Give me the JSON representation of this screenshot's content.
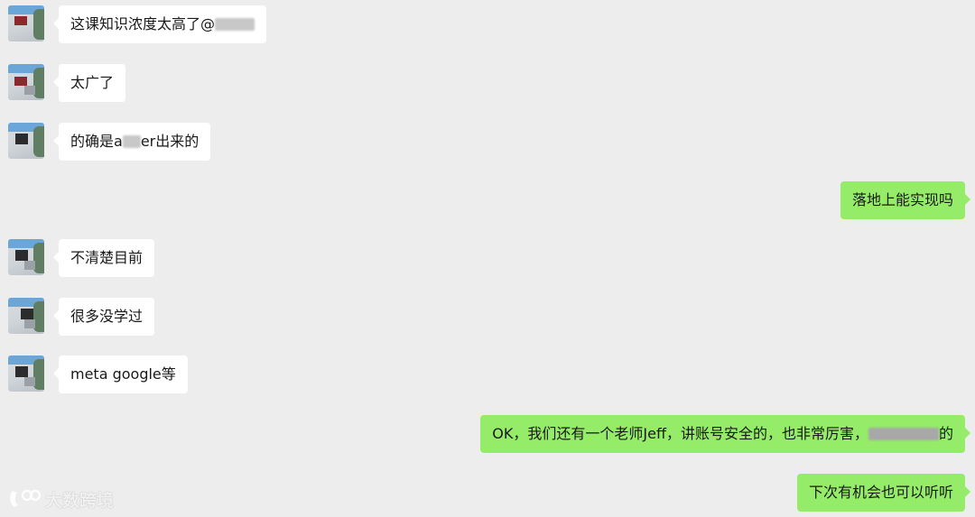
{
  "messages": [
    {
      "side": "left",
      "parts": [
        "这课知识浓度太高了@",
        "█████"
      ]
    },
    {
      "side": "left",
      "parts": [
        "太广了"
      ]
    },
    {
      "side": "left",
      "parts": [
        "的确是a",
        "██",
        "er出来的"
      ]
    },
    {
      "side": "right",
      "parts": [
        "落地上能实现吗"
      ]
    },
    {
      "side": "left",
      "parts": [
        "不清楚目前"
      ]
    },
    {
      "side": "left",
      "parts": [
        "很多没学过"
      ]
    },
    {
      "side": "left",
      "parts": [
        "meta google等"
      ]
    },
    {
      "side": "right",
      "parts": [
        "OK，我们还有一个老师Jeff，讲账号安全的，也非常厉害，",
        "██████",
        "的"
      ]
    },
    {
      "side": "right",
      "parts": [
        "下次有机会也可以听听"
      ]
    }
  ],
  "watermark": {
    "text": "大数跨境",
    "icon": "brand-logo-icon"
  },
  "colors": {
    "background": "#ededed",
    "incoming": "#ffffff",
    "outgoing": "#95ec69",
    "text": "#191919"
  }
}
